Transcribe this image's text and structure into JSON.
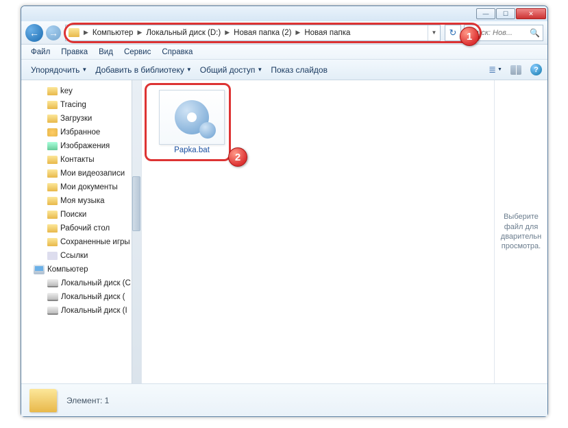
{
  "breadcrumb": [
    "Компьютер",
    "Локальный диск (D:)",
    "Новая папка (2)",
    "Новая папка"
  ],
  "search": {
    "placeholder": "Поиск: Нов..."
  },
  "menu": {
    "file": "Файл",
    "edit": "Правка",
    "view": "Вид",
    "tools": "Сервис",
    "help": "Справка"
  },
  "toolbar": {
    "organize": "Упорядочить",
    "library": "Добавить в библиотеку",
    "share": "Общий доступ",
    "slideshow": "Показ слайдов"
  },
  "tree": {
    "items": [
      {
        "label": "key",
        "icon": "folder"
      },
      {
        "label": "Tracing",
        "icon": "folder"
      },
      {
        "label": "Загрузки",
        "icon": "folder"
      },
      {
        "label": "Избранное",
        "icon": "star"
      },
      {
        "label": "Изображения",
        "icon": "pic"
      },
      {
        "label": "Контакты",
        "icon": "folder"
      },
      {
        "label": "Мои видеозаписи",
        "icon": "folder"
      },
      {
        "label": "Мои документы",
        "icon": "folder"
      },
      {
        "label": "Моя музыка",
        "icon": "folder"
      },
      {
        "label": "Поиски",
        "icon": "search"
      },
      {
        "label": "Рабочий стол",
        "icon": "folder"
      },
      {
        "label": "Сохраненные игры",
        "icon": "folder"
      },
      {
        "label": "Ссылки",
        "icon": "link"
      }
    ],
    "computer": "Компьютер",
    "drives": [
      "Локальный диск (C",
      "Локальный диск (",
      "Локальный диск (I"
    ]
  },
  "file": {
    "name": "Papka.bat"
  },
  "preview": {
    "hint": "Выберите файл для дварительн просмотра."
  },
  "status": {
    "text": "Элемент: 1"
  },
  "markers": {
    "one": "1",
    "two": "2"
  }
}
